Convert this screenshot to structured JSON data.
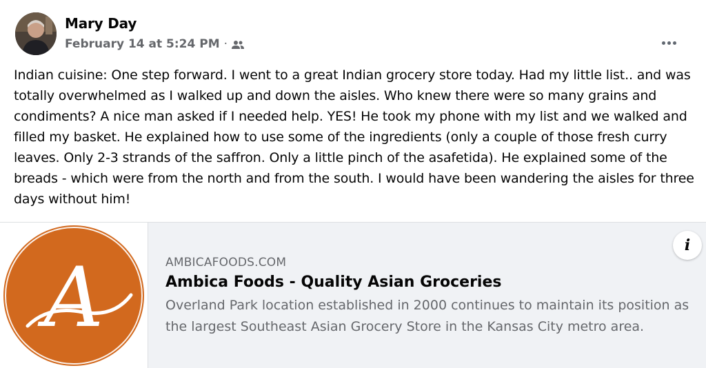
{
  "post": {
    "author": "Mary Day",
    "date": "February 14 at 5:24 PM",
    "separator": "·",
    "audience_icon": "friends-icon",
    "more_icon": "more-options-icon",
    "text": "Indian cuisine: One step forward. I went to a great Indian grocery store today. Had my little list.. and was totally overwhelmed as I walked up and down the aisles. Who knew there were so many grains and condiments? A nice man asked if I needed help. YES! He took my phone with my list and we walked and filled my basket. He explained how to use some of the ingredients (only a couple of those fresh curry leaves. Only 2-3 strands of the saffron. Only a little pinch of the asafetida). He explained some of the breads - which were from the north and from the south. I would have been wandering the aisles for three days without him!"
  },
  "link_preview": {
    "domain": "AMBICAFOODS.COM",
    "title": "Ambica Foods - Quality Asian Groceries",
    "description": "Overland Park location established in 2000 continues to maintain its position as the largest Southeast Asian Grocery Store in the Kansas City metro area.",
    "logo_letter": "A",
    "info_label": "i"
  },
  "colors": {
    "logo_orange": "#d2691e",
    "secondary_text": "#65676b",
    "card_bg": "#f0f2f5"
  }
}
